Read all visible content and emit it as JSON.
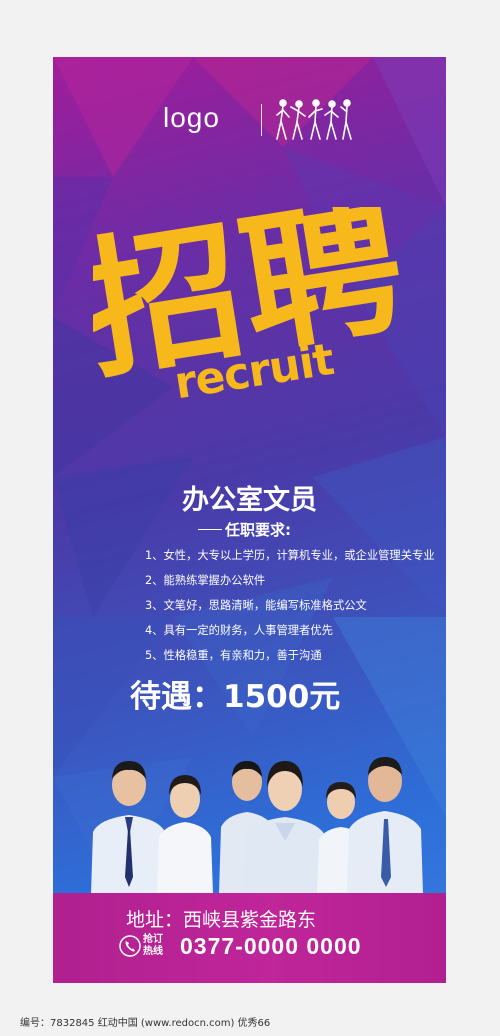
{
  "poster": {
    "logo": "logo",
    "title_zh": "招聘",
    "title_en": "recruit",
    "job_title": "办公室文员",
    "requirements_heading": "任职要求:",
    "requirements": [
      "1、女性，大专以上学历，计算机专业，或企业管理关专业",
      "2、能熟练掌握办公软件",
      "3、文笔好，思路清晰，能编写标准格式公文",
      "4、具有一定的财务，人事管理者优先",
      "5、性格稳重，有亲和力，善于沟通"
    ],
    "salary": "待遇：1500元",
    "address": "地址：西峡县紫金路东",
    "hotline_label": "抢订热线",
    "phone": "0377-0000 0000"
  },
  "watermark": "编号：7832845    红动中国 (www.redocn.com)    优秀66",
  "colors": {
    "accent_yellow": "#f7b81b",
    "footer_magenta": "#c0259a",
    "bg_top": "#a21c9a",
    "bg_bottom": "#2e6ed8"
  },
  "icons": [
    "phone-icon",
    "dancers-logo-icon"
  ]
}
